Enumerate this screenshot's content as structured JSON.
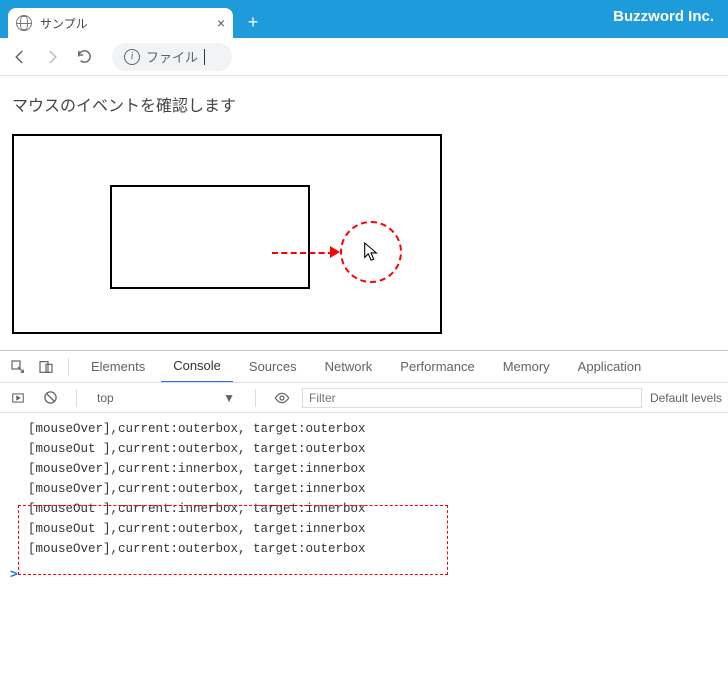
{
  "brand": "Buzzword Inc.",
  "tab": {
    "title": "サンプル"
  },
  "omnibox": {
    "text": "ファイル"
  },
  "page": {
    "heading": "マウスのイベントを確認します"
  },
  "devtools": {
    "tabs": {
      "elements": "Elements",
      "console": "Console",
      "sources": "Sources",
      "network": "Network",
      "performance": "Performance",
      "memory": "Memory",
      "application": "Application"
    },
    "context": "top",
    "filter_placeholder": "Filter",
    "level": "Default levels",
    "logs": [
      "[mouseOver],current:outerbox, target:outerbox",
      "[mouseOut ],current:outerbox, target:outerbox",
      "[mouseOver],current:innerbox, target:innerbox",
      "[mouseOver],current:outerbox, target:innerbox",
      "[mouseOut ],current:innerbox, target:innerbox",
      "[mouseOut ],current:outerbox, target:innerbox",
      "[mouseOver],current:outerbox, target:outerbox"
    ],
    "highlight": {
      "start": 4,
      "end": 6
    },
    "prompt": ">"
  }
}
